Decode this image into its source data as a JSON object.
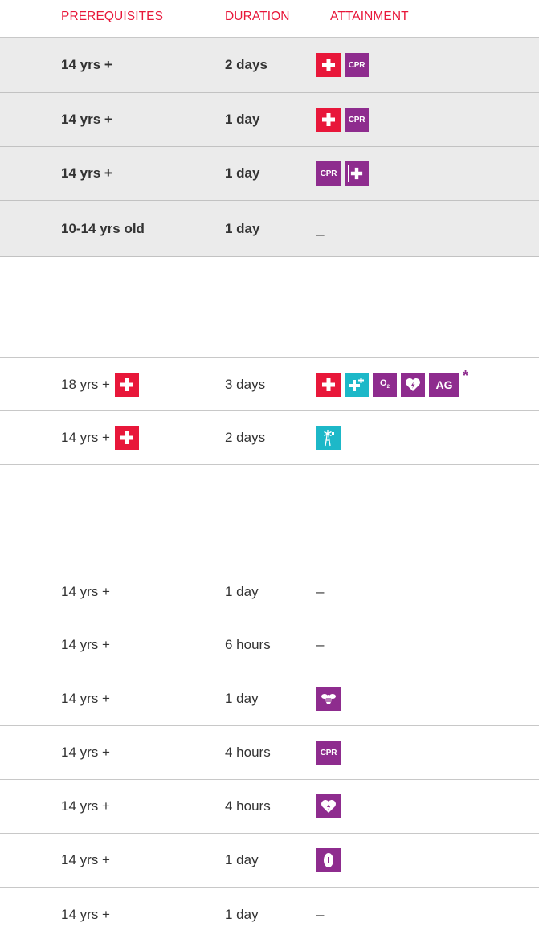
{
  "header": {
    "col_prerequisites": "PREREQUISITES",
    "col_duration": "DURATION",
    "col_attainment": "ATTAINMENT"
  },
  "colors": {
    "accent_red": "#e8173a",
    "purple": "#8e2c8e",
    "teal": "#1db8c8",
    "row_grey": "#ebebeb"
  },
  "section1": {
    "rows": [
      {
        "prerequisites": "14 yrs +",
        "duration": "2 days",
        "icons": [
          "first-aid-cross-icon",
          "cpr-icon"
        ]
      },
      {
        "prerequisites": "14 yrs +",
        "duration": "1 day",
        "icons": [
          "first-aid-cross-icon",
          "cpr-icon"
        ]
      },
      {
        "prerequisites": "14 yrs +",
        "duration": "1 day",
        "icons": [
          "cpr-icon",
          "outlined-cross-icon"
        ]
      },
      {
        "prerequisites": "10-14 yrs old",
        "duration": "1 day",
        "attainment_text": "_"
      }
    ]
  },
  "section2": {
    "rows": [
      {
        "prerequisites": "18 yrs +",
        "duration": "3 days",
        "prereq_icon": "first-aid-cross-icon",
        "icons": [
          "first-aid-cross-icon",
          "advanced-first-aid-icon",
          "oxygen-icon",
          "defibrillator-heart-icon",
          "ag-icon"
        ],
        "asterisk": "*",
        "ag_label": "AG",
        "o2_label": "O"
      },
      {
        "prerequisites": "14 yrs +",
        "duration": "2 days",
        "prereq_icon": "first-aid-cross-icon",
        "icons": [
          "remote-windmill-icon"
        ]
      }
    ]
  },
  "section3": {
    "rows": [
      {
        "prerequisites": "14 yrs +",
        "duration": "1 day",
        "attainment_text": "–"
      },
      {
        "prerequisites": "14 yrs +",
        "duration": "6 hours",
        "attainment_text": "–"
      },
      {
        "prerequisites": "14 yrs +",
        "duration": "1 day",
        "icons": [
          "bee-anaphylaxis-icon"
        ]
      },
      {
        "prerequisites": "14 yrs +",
        "duration": "4 hours",
        "icons": [
          "cpr-icon"
        ]
      },
      {
        "prerequisites": "14 yrs +",
        "duration": "4 hours",
        "icons": [
          "defibrillator-heart-icon"
        ]
      },
      {
        "prerequisites": "14 yrs +",
        "duration": "1 day",
        "icons": [
          "asthma-inhaler-icon"
        ]
      },
      {
        "prerequisites": "14 yrs +",
        "duration": "1 day",
        "attainment_text": "–"
      }
    ]
  },
  "labels": {
    "cpr": "CPR"
  }
}
